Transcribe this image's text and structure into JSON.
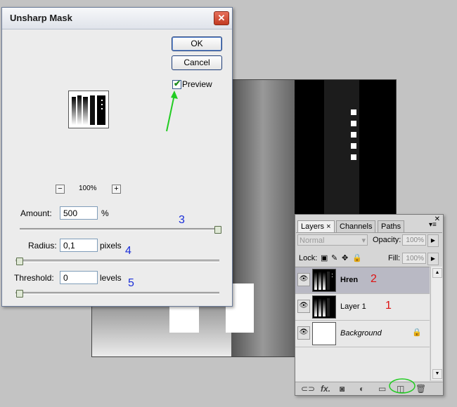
{
  "dialog": {
    "title": "Unsharp Mask",
    "ok_label": "OK",
    "cancel_label": "Cancel",
    "preview_label": "Preview",
    "preview_checked": true,
    "zoom_out": "−",
    "zoom_in": "+",
    "zoom_level": "100%",
    "amount_label": "Amount:",
    "amount_value": "500",
    "amount_unit": "%",
    "radius_label": "Radius:",
    "radius_value": "0,1",
    "radius_unit": "pixels",
    "threshold_label": "Threshold:",
    "threshold_value": "0",
    "threshold_unit": "levels",
    "close_glyph": "✕"
  },
  "annotations": {
    "amount_num": "3",
    "radius_num": "4",
    "threshold_num": "5",
    "layer_hren_num": "2",
    "layer1_num": "1",
    "amount_color": "#1a2ed8",
    "arrow_color": "#22cc22",
    "layer_num_color": "#dd1111"
  },
  "panel": {
    "tabs": [
      "Layers",
      "Channels",
      "Paths"
    ],
    "tab_close": "×",
    "blend_mode": "Normal",
    "opacity_label": "Opacity:",
    "opacity_value": "100%",
    "lock_label": "Lock:",
    "fill_label": "Fill:",
    "fill_value": "100%",
    "layers": [
      {
        "name": "Hren",
        "selected": true
      },
      {
        "name": "Layer 1",
        "selected": false
      },
      {
        "name": "Background",
        "selected": false
      }
    ],
    "bottom_icons": [
      "link-icon",
      "fx-icon",
      "mask-icon",
      "adjustment-icon",
      "group-icon",
      "new-layer-icon",
      "trash-icon"
    ],
    "fx_label": "fx."
  }
}
